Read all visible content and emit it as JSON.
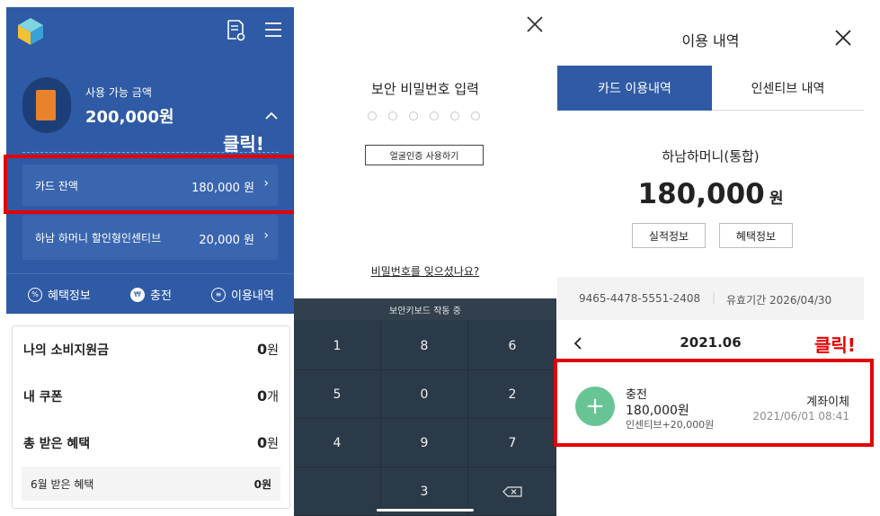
{
  "panel1": {
    "available_label": "사용 가능 금액",
    "available_amount": "200,000원",
    "click_label": "클릭!",
    "rows": [
      {
        "label": "카드 잔액",
        "value": "180,000 원"
      },
      {
        "label": "하남 하머니 할인형인센티브",
        "value": "20,000 원"
      }
    ],
    "nav": [
      {
        "label": "혜택정보",
        "icon": "percent-icon",
        "glyph": "%"
      },
      {
        "label": "충전",
        "icon": "won-icon",
        "glyph": "₩"
      },
      {
        "label": "이용내역",
        "icon": "list-icon",
        "glyph": "≡"
      }
    ],
    "list": [
      {
        "label": "나의 소비지원금",
        "value": "0",
        "unit": "원"
      },
      {
        "label": "내 쿠폰",
        "value": "0",
        "unit": "개"
      },
      {
        "label": "총 받은 혜택",
        "value": "0",
        "unit": "원"
      },
      {
        "label": "6월 받은 혜택",
        "value": "0원"
      }
    ],
    "colors": {
      "header": "#2f5aa5",
      "highlight": "#e30000",
      "accent": "#1a4a9c"
    }
  },
  "panel2": {
    "title": "보안 비밀번호 입력",
    "face_button": "얼굴인증 사용하기",
    "forgot_link": "비밀번호를 잊으셨나요?",
    "keypad_status": "보안키보드 작동 중",
    "keys": [
      "1",
      "8",
      "6",
      "5",
      "0",
      "2",
      "4",
      "9",
      "7",
      "",
      "3",
      "⌫"
    ]
  },
  "panel3": {
    "title": "이용 내역",
    "tabs": [
      "카드 이용내역",
      "인센티브 내역"
    ],
    "card_name": "하남하머니(통합)",
    "balance": "180,000",
    "balance_unit": "원",
    "btn_perf": "실적정보",
    "btn_benefit": "혜택정보",
    "card_number": "9465-4478-5551-2408",
    "expiry": "유효기간  2026/04/30",
    "month": "2021.06",
    "click_label": "클릭!",
    "transaction": {
      "type": "충전",
      "amount": "180,000원",
      "incentive": "인센티브+20,000원",
      "method": "계좌이체",
      "datetime": "2021/06/01 08:41"
    },
    "colors": {
      "tab_active": "#2f5aa5",
      "plus_circle": "#68c494"
    }
  }
}
